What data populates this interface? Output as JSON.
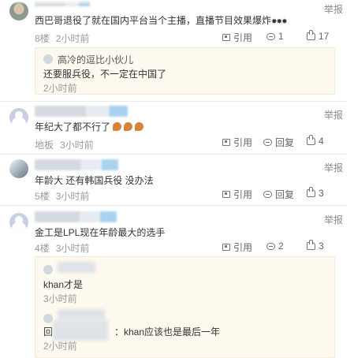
{
  "posts": [
    {
      "content": "西巴哥退役了就在国内平台当个主播，直播节目效果爆炸",
      "content_suffix": "✸✸✸",
      "floor": "8楼",
      "time": "2小时前",
      "quote_label": "引用",
      "reply_count": "1",
      "like_count": "17",
      "report": "举报",
      "reply": {
        "name": "高冷的逗比小伙儿",
        "text": "还要服兵役，不一定在中国了",
        "time": "2小时前"
      }
    },
    {
      "content": "年纪大了都不行了",
      "floor": "地板",
      "time": "3小时前",
      "quote_label": "引用",
      "reply_label": "回复",
      "like_count": "4",
      "report": "举报"
    },
    {
      "content": "年龄大 还有韩国兵役 没办法",
      "floor": "5楼",
      "time": "3小时前",
      "quote_label": "引用",
      "reply_label": "回复",
      "like_count": "3",
      "report": "举报"
    },
    {
      "content": "金工是LPL现在年龄最大的选手",
      "floor": "4楼",
      "time": "3小时前",
      "quote_label": "引用",
      "reply_count": "2",
      "like_count": "3",
      "report": "举报",
      "replies": [
        {
          "text": "khan才是",
          "time": "3小时前"
        },
        {
          "prefix": "回",
          "text": "：khan应该也是最后一年",
          "time": "2小时前"
        }
      ]
    }
  ]
}
